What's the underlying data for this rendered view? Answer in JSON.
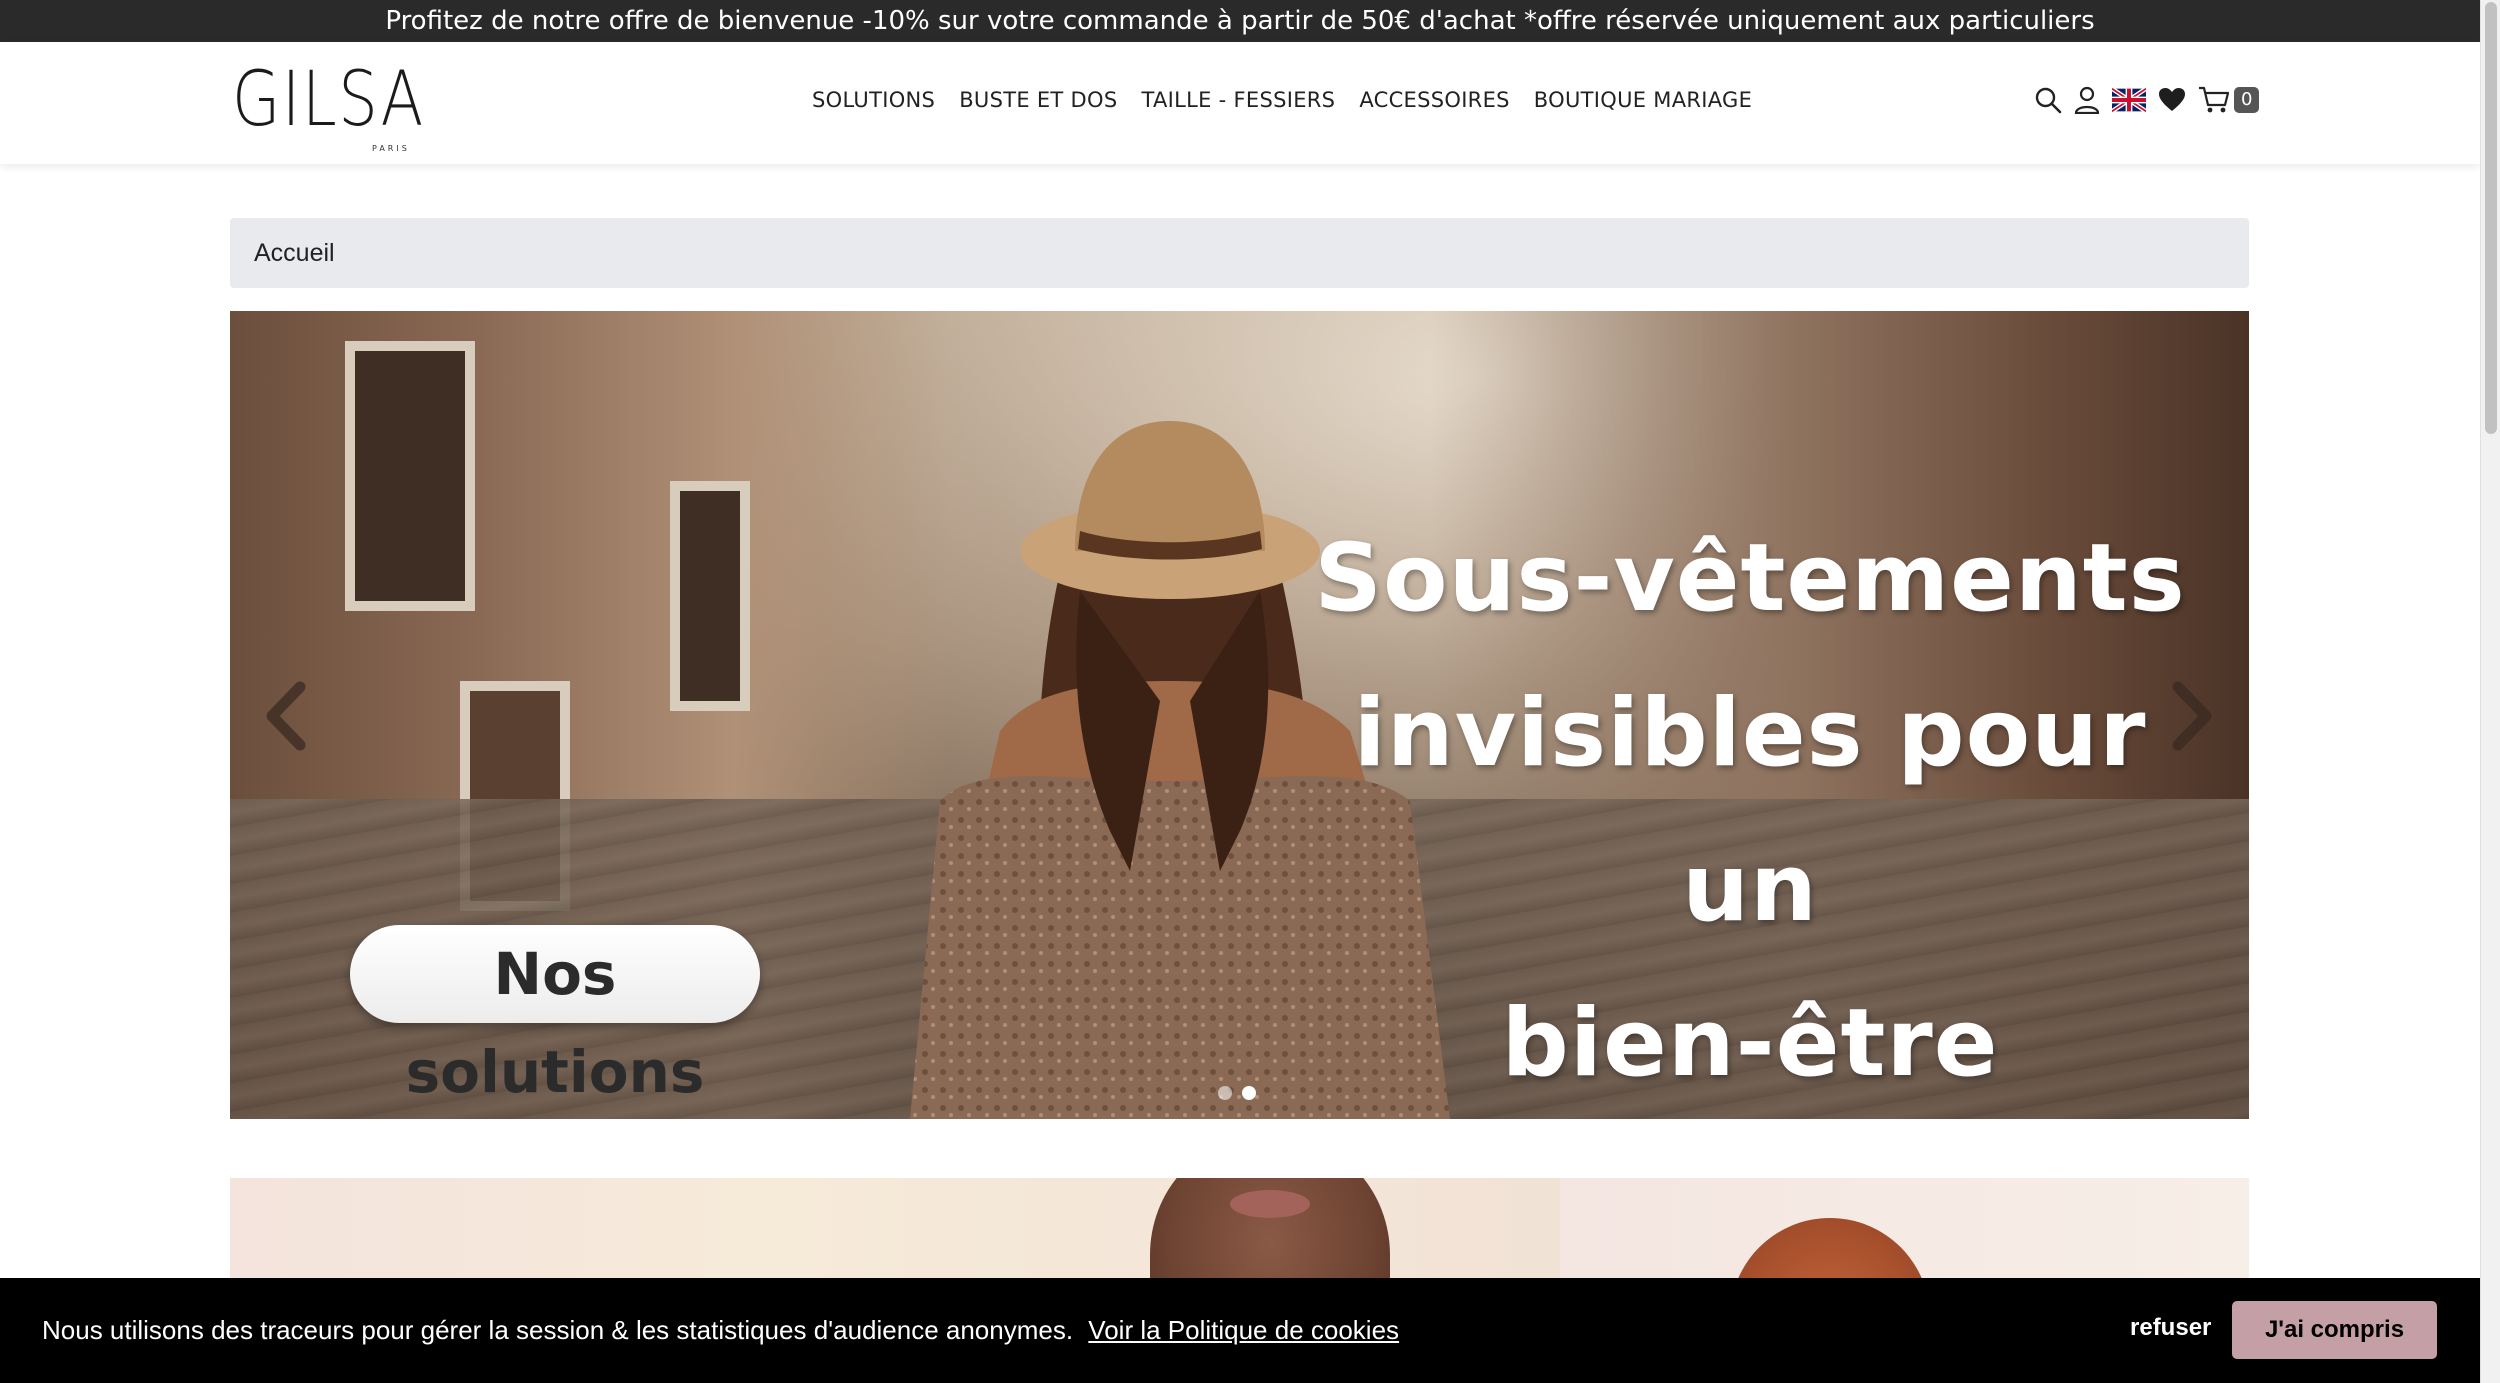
{
  "promo": {
    "text": "Profitez de notre offre de bienvenue -10% sur votre commande à partir de 50€ d'achat *offre réservée uniquement aux particuliers"
  },
  "header": {
    "logo": {
      "text": "GILSA",
      "sub": "PARIS"
    },
    "nav": [
      "SOLUTIONS",
      "BUSTE ET DOS",
      "TAILLE - FESSIERS",
      "ACCESSOIRES",
      "BOUTIQUE MARIAGE"
    ],
    "icons": [
      "search-icon",
      "user-icon",
      "uk-flag-icon",
      "heart-icon",
      "cart-icon"
    ],
    "cart_count": "0"
  },
  "breadcrumb": {
    "home": "Accueil"
  },
  "hero": {
    "title_lines": [
      "Sous-vêtements",
      "invisibles pour un",
      "bien-être visible !"
    ],
    "button_label": "Nos solutions",
    "slides_total": 2,
    "active_slide": 2
  },
  "cookie": {
    "text": "Nous utilisons des traceurs pour gérer la session & les statistiques d'audience anonymes.",
    "link": "Voir la Politique de cookies",
    "refuse": "refuser",
    "accept": "J'ai compris",
    "accept_color": "#c4a0a6"
  },
  "colors": {
    "promo_bg": "#2a2a2a",
    "breadcrumb_bg": "#e9eaed",
    "cookie_bg": "#000000"
  }
}
